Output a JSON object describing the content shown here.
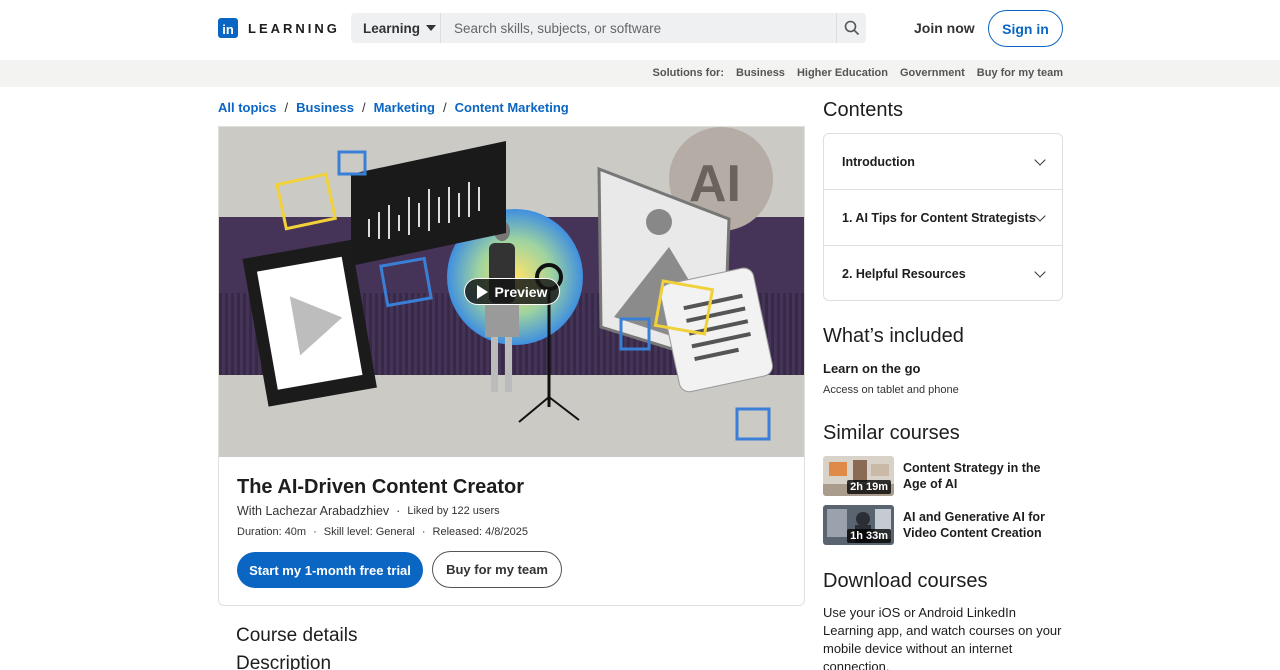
{
  "header": {
    "logo_letters": "in",
    "logo_word": "LEARNING",
    "search_category": "Learning",
    "search_placeholder": "Search skills, subjects, or software",
    "join_label": "Join now",
    "signin_label": "Sign in"
  },
  "solutions": {
    "label": "Solutions for:",
    "items": [
      "Business",
      "Higher Education",
      "Government",
      "Buy for my team"
    ]
  },
  "breadcrumb": [
    "All topics",
    "Business",
    "Marketing",
    "Content Marketing"
  ],
  "hero": {
    "preview_label": "Preview",
    "art_text": "AI"
  },
  "course": {
    "title": "The AI-Driven Content Creator",
    "author": "With Lachezar Arabadzhiev",
    "liked": "Liked by 122 users",
    "duration": "Duration: 40m",
    "skill": "Skill level: General",
    "released": "Released: 4/8/2025",
    "primary_cta": "Start my 1-month free trial",
    "secondary_cta": "Buy for my team"
  },
  "details_heading": "Course details",
  "description_heading": "Description",
  "contents": {
    "heading": "Contents",
    "items": [
      "Introduction",
      "1. AI Tips for Content Strategists",
      "2. Helpful Resources"
    ]
  },
  "included": {
    "heading": "What’s included",
    "title": "Learn on the go",
    "subtitle": "Access on tablet and phone"
  },
  "similar": {
    "heading": "Similar courses",
    "items": [
      {
        "title": "Content Strategy in the Age of AI",
        "duration": "2h 19m"
      },
      {
        "title": "AI and Generative AI for Video Content Creation",
        "duration": "1h 33m"
      }
    ]
  },
  "download": {
    "heading": "Download courses",
    "text": "Use your iOS or Android LinkedIn Learning app, and watch courses on your mobile device without an internet connection."
  }
}
